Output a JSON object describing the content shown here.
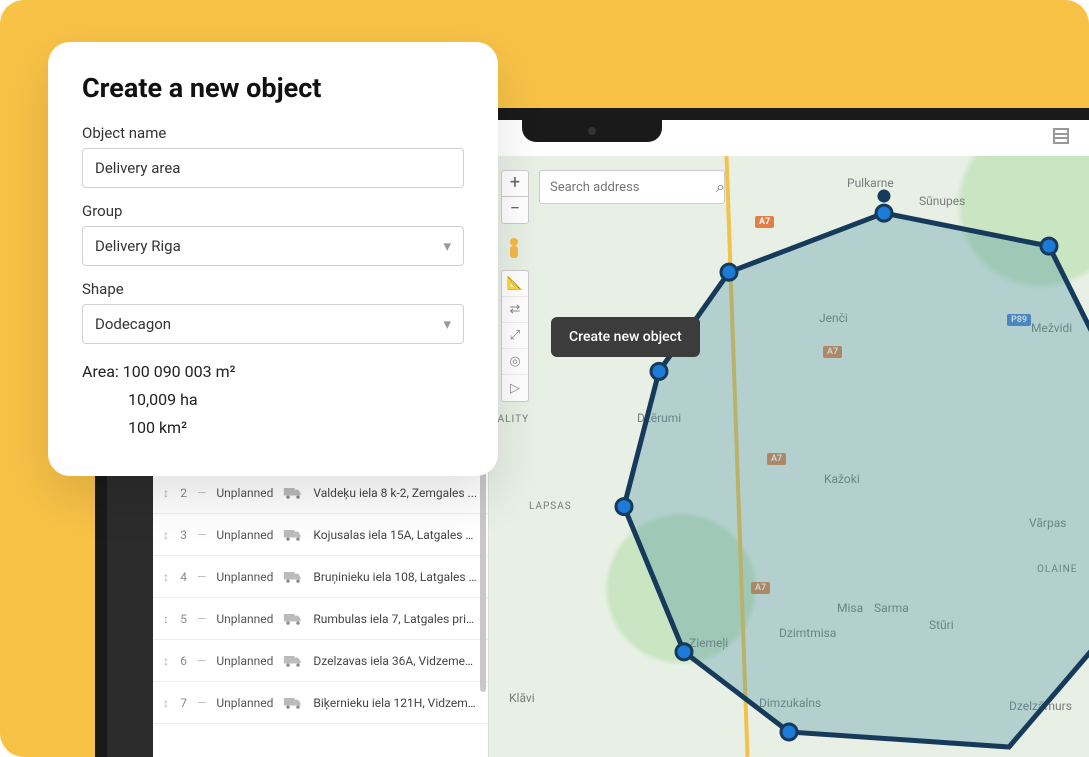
{
  "modal": {
    "title": "Create a new object",
    "labels": {
      "name": "Object name",
      "group": "Group",
      "shape": "Shape"
    },
    "values": {
      "name": "Delivery area",
      "group": "Delivery Riga",
      "shape": "Dodecagon"
    },
    "area": {
      "label": "Area:",
      "m2": "100 090 003 m²",
      "ha": "10,009 ha",
      "km2": "100 km²"
    }
  },
  "tooltip": "Create new object",
  "search": {
    "placeholder": "Search address"
  },
  "zoom": {
    "in": "+",
    "out": "−"
  },
  "tasks": [
    {
      "n": "2",
      "status": "Unplanned",
      "addr": "Valdeķu iela 8 k-2, Zemgales ..."
    },
    {
      "n": "3",
      "status": "Unplanned",
      "addr": "Kojusalas iela 15A, Latgales pr..."
    },
    {
      "n": "4",
      "status": "Unplanned",
      "addr": "Bruņinieku iela 108, Latgales ..."
    },
    {
      "n": "5",
      "status": "Unplanned",
      "addr": "Rumbulas iela 7, Latgales prie..."
    },
    {
      "n": "6",
      "status": "Unplanned",
      "addr": "Dzelzavas iela 36A, Vidzemes ..."
    },
    {
      "n": "7",
      "status": "Unplanned",
      "addr": "Biķernieku iela 121H, Vidzeme..."
    }
  ],
  "map_labels": {
    "pulkarne": "Pulkarne",
    "sunupes": "Sūnupes",
    "jenci": "Jenči",
    "mezvidi": "Mežvidi",
    "dzerumi": "Dzērumi",
    "lapsas": "LAPSAS",
    "kazoki": "Kažoki",
    "varpas": "Vārpas",
    "olaine": "OLAINE",
    "misa": "Misa",
    "sarma": "Sarma",
    "dzimtmisa": "Dzimtmisa",
    "sturi": "Stūri",
    "ziemeli": "Ziemeļi",
    "klavi": "Klāvi",
    "dimzukalns": "Dimzukalns",
    "dzelzamurs": "Dzelzāmurs",
    "pality": "PALITY"
  },
  "routes": {
    "a7": "A7",
    "p89": "P89"
  }
}
